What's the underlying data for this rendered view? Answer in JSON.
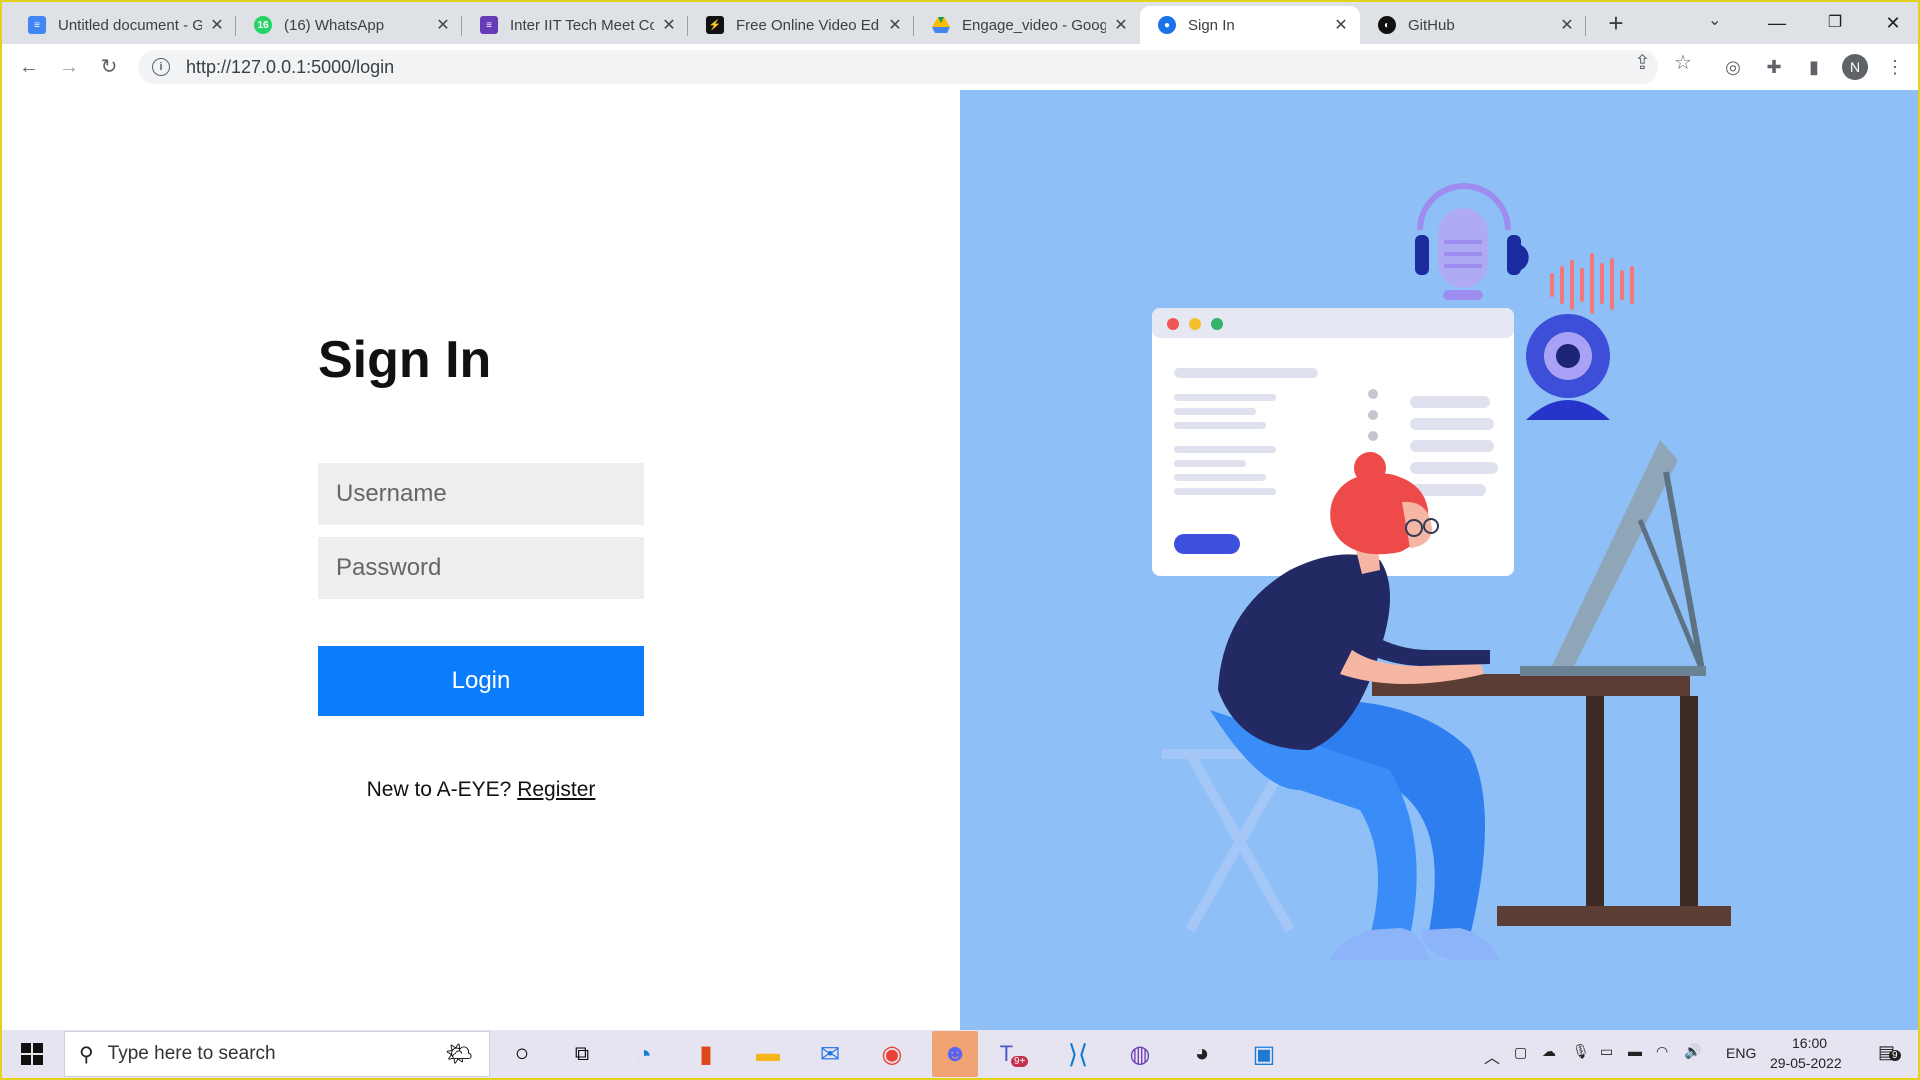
{
  "browser": {
    "tabs": [
      {
        "title": "Untitled document - G",
        "favicon": "google-docs-icon",
        "color": "#4285f4"
      },
      {
        "title": "(16) WhatsApp",
        "favicon": "whatsapp-icon",
        "color": "#25d366"
      },
      {
        "title": "Inter IIT Tech Meet Co",
        "favicon": "google-forms-icon",
        "color": "#673ab7"
      },
      {
        "title": "Free Online Video Edi",
        "favicon": "video-editor-icon",
        "color": "#111111"
      },
      {
        "title": "Engage_video - Googl",
        "favicon": "google-drive-icon",
        "color": "#1fa463"
      },
      {
        "title": "Sign In",
        "favicon": "globe-icon",
        "color": "#1a73e8",
        "active": true
      },
      {
        "title": "GitHub",
        "favicon": "github-icon",
        "color": "#111111"
      }
    ],
    "address_bar": {
      "url": "http://127.0.0.1:5000/login"
    },
    "profile_initial": "N"
  },
  "page": {
    "title": "Sign In",
    "username_placeholder": "Username",
    "password_placeholder": "Password",
    "login_label": "Login",
    "register_prompt": "New to A-EYE?",
    "register_link": "Register",
    "illustration_bg": "#8fbff7",
    "button_color": "#0a7cfc"
  },
  "taskbar": {
    "search_placeholder": "Type here to search",
    "language": "ENG",
    "time": "16:00",
    "date": "29-05-2022",
    "teams_badge": "9+",
    "notification_count": "9"
  }
}
